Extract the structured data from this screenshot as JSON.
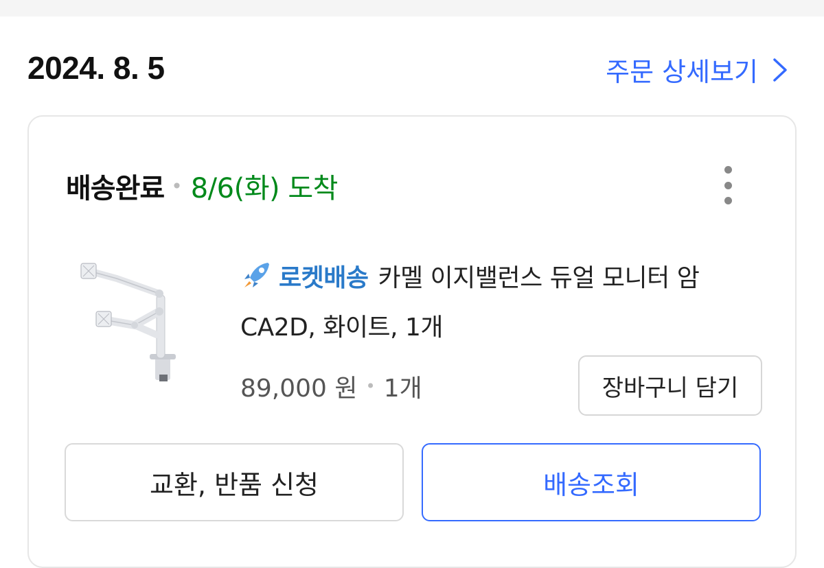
{
  "order": {
    "date": "2024. 8. 5",
    "detail_link_label": "주문 상세보기"
  },
  "card": {
    "status": "배송완료",
    "arrival": "8/6(화) 도착",
    "product": {
      "delivery_badge": "로켓배송",
      "name": "카멜 이지밸런스 듀얼 모니터 암 CA2D, 화이트, 1개",
      "price": "89,000 원",
      "quantity": "1개",
      "image_icon": "monitor-arm-product-image"
    },
    "cart_button_label": "장바구니 담기",
    "exchange_return_label": "교환, 반품 신청",
    "tracking_label": "배송조회"
  },
  "colors": {
    "accent_blue": "#346aff",
    "arrival_green": "#00891a",
    "rocket_blue": "#2a7ac9"
  }
}
